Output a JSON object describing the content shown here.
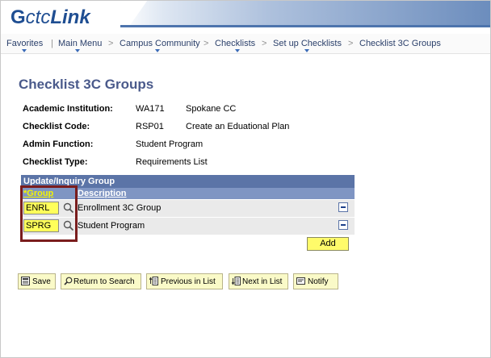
{
  "brand": {
    "logo_glyph": "G",
    "logo_prefix": "ctc",
    "logo_suffix": "Link"
  },
  "breadcrumb": [
    {
      "label": "Favorites"
    },
    {
      "label": "Main Menu"
    },
    {
      "label": "Campus Community"
    },
    {
      "label": "Checklists"
    },
    {
      "label": "Set up Checklists"
    },
    {
      "label": "Checklist 3C Groups"
    }
  ],
  "page": {
    "title": "Checklist 3C Groups",
    "fields": [
      {
        "label": "Academic Institution:",
        "code": "WA171",
        "value": "Spokane CC"
      },
      {
        "label": "Checklist Code:",
        "code": "RSP01",
        "value": "Create an Eduational Plan"
      },
      {
        "label": "Admin Function:",
        "code": "",
        "value": "Student Program"
      },
      {
        "label": "Checklist Type:",
        "code": "",
        "value": "Requirements List"
      }
    ]
  },
  "grid": {
    "title": "Update/Inquiry Group",
    "col_group": "*Group",
    "col_desc": "Description",
    "rows": [
      {
        "group": "ENRL",
        "description": "Enrollment 3C Group"
      },
      {
        "group": "SPRG",
        "description": "Student Program"
      }
    ],
    "add_label": "Add"
  },
  "toolbar": {
    "save": "Save",
    "return": "Return to Search",
    "prev": "Previous in List",
    "next": "Next in List",
    "notify": "Notify"
  },
  "colors": {
    "title": "#4a5a8b",
    "grid_header": "#5b74a7",
    "grid_col_header": "#7f95c3",
    "input_highlight": "#ffff5a",
    "callout_border": "#7a1d1d"
  }
}
